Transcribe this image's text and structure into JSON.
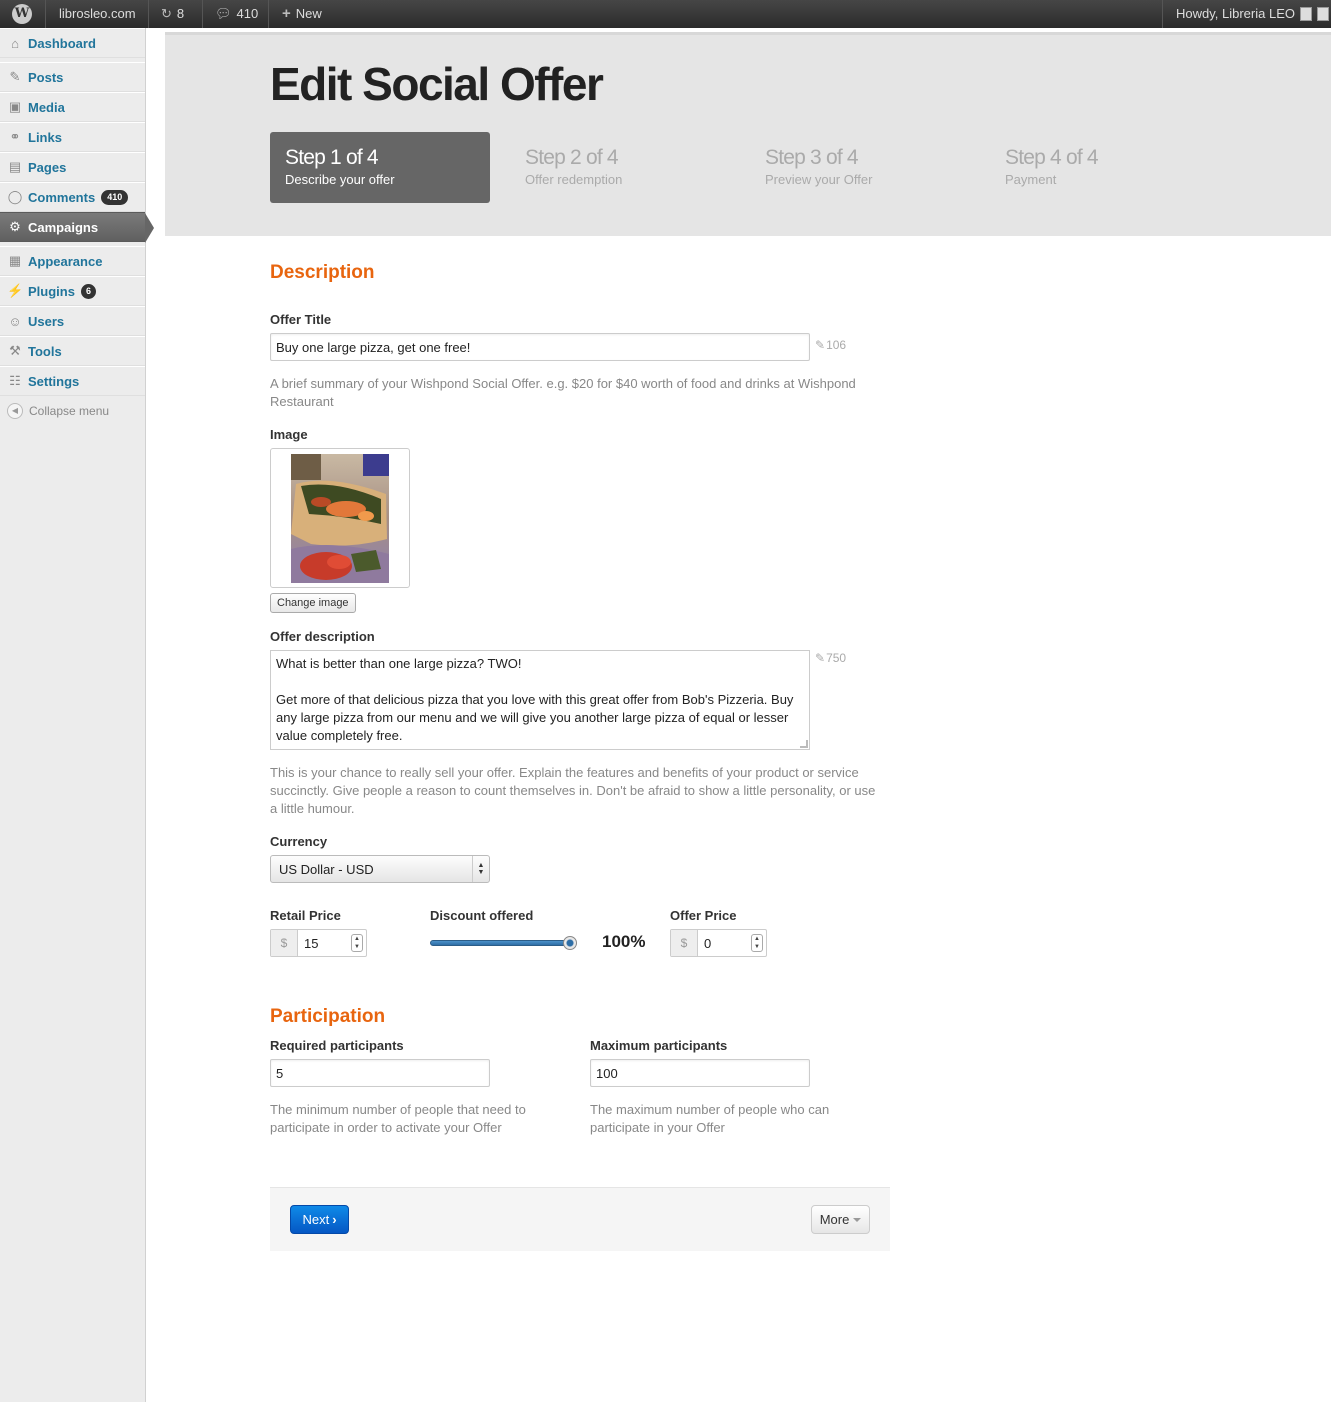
{
  "adminbar": {
    "site_name": "librosleo.com",
    "updates_count": "8",
    "comments_count": "410",
    "new_label": "New",
    "howdy": "Howdy, Libreria LEO"
  },
  "sidebar": {
    "items": [
      {
        "label": "Dashboard",
        "icon": "dashboard-icon"
      },
      {
        "label": "Posts",
        "icon": "pin-icon"
      },
      {
        "label": "Media",
        "icon": "media-icon"
      },
      {
        "label": "Links",
        "icon": "link-icon"
      },
      {
        "label": "Pages",
        "icon": "page-icon"
      },
      {
        "label": "Comments",
        "icon": "comment-icon",
        "badge": "410"
      },
      {
        "label": "Campaigns",
        "icon": "gear-icon"
      },
      {
        "label": "Appearance",
        "icon": "appearance-icon"
      },
      {
        "label": "Plugins",
        "icon": "plug-icon",
        "badge": "6"
      },
      {
        "label": "Users",
        "icon": "users-icon"
      },
      {
        "label": "Tools",
        "icon": "tools-icon"
      },
      {
        "label": "Settings",
        "icon": "settings-icon"
      }
    ],
    "collapse_label": "Collapse menu"
  },
  "header": {
    "title": "Edit Social Offer",
    "steps": [
      {
        "title": "Step 1 of 4",
        "subtitle": "Describe your offer"
      },
      {
        "title": "Step 2 of 4",
        "subtitle": "Offer redemption"
      },
      {
        "title": "Step 3 of 4",
        "subtitle": "Preview your Offer"
      },
      {
        "title": "Step 4 of 4",
        "subtitle": "Payment"
      }
    ]
  },
  "description": {
    "section_title": "Description",
    "offer_title_label": "Offer Title",
    "offer_title_value": "Buy one large pizza, get one free!",
    "offer_title_counter": "106",
    "offer_title_help": "A brief summary of your Wishpond Social Offer. e.g. $20 for $40 worth of food and drinks at Wishpond Restaurant",
    "image_label": "Image",
    "change_image_label": "Change image",
    "offer_desc_label": "Offer description",
    "offer_desc_line1": "What is better than one large pizza? TWO!",
    "offer_desc_line2": "Get more of that delicious pizza that you love with this great offer from Bob's Pizzeria. Buy any large pizza from our menu and we will give you another large pizza of equal or lesser value completely free.",
    "offer_desc_counter": "750",
    "offer_desc_help": "This is your chance to really sell your offer. Explain the features and benefits of your product or service succinctly. Give people a reason to count themselves in. Don't be afraid to show a little personality, or use a little humour.",
    "currency_label": "Currency",
    "currency_value": "US Dollar - USD",
    "retail_label": "Retail Price",
    "retail_addon": "$",
    "retail_value": "15",
    "discount_label": "Discount offered",
    "discount_value": 1.0,
    "discount_text": "100%",
    "offer_price_label": "Offer Price",
    "offer_price_addon": "$",
    "offer_price_value": "0"
  },
  "participation": {
    "section_title": "Participation",
    "required_label": "Required participants",
    "required_value": "5",
    "required_help": "The minimum number of people that need to participate in order to activate your Offer",
    "maximum_label": "Maximum participants",
    "maximum_value": "100",
    "maximum_help": "The maximum number of people who can participate in your Offer"
  },
  "actions": {
    "next_label": "Next",
    "more_label": "More"
  }
}
